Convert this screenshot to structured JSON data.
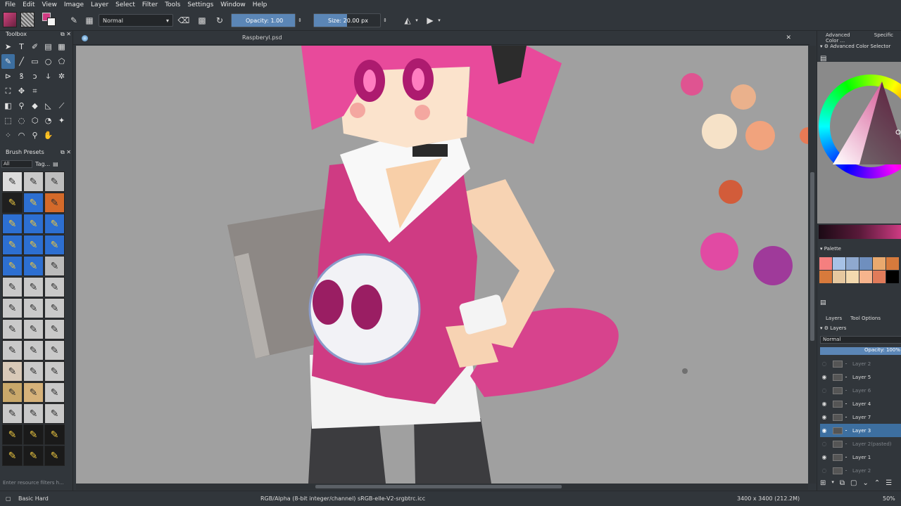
{
  "menu": [
    "File",
    "Edit",
    "View",
    "Image",
    "Layer",
    "Select",
    "Filter",
    "Tools",
    "Settings",
    "Window",
    "Help"
  ],
  "toolbar": {
    "blend_mode": "Normal",
    "opacity_label": "Opacity:",
    "opacity_value": "1.00",
    "opacity_fraction": 1.0,
    "size_label": "Size:",
    "size_value": "20.00 px",
    "size_fraction": 0.5
  },
  "document": {
    "title": "Raspberyl.psd"
  },
  "toolbox": {
    "title": "Toolbox"
  },
  "brush_presets": {
    "title": "Brush Presets",
    "filter_select": "All",
    "tag_label": "Tag...",
    "filter_placeholder": "Enter resource filters h..."
  },
  "right": {
    "tabs": [
      "Advanced Color ...",
      "Specific"
    ],
    "color_selector_title": "Advanced Color Selector",
    "palette_title": "Palette",
    "palette_colors": [
      "#f57f7f",
      "#a7c2e6",
      "#8fa9cf",
      "#6f8fbe",
      "#e9a96e",
      "#d77a3c",
      "#d77a3c",
      "#e6c89f",
      "#f3d9ae",
      "#f6b48d",
      "#e07b5a",
      "#000000"
    ],
    "layer_tabs": [
      "Layers",
      "Tool Options"
    ],
    "layers_title": "Layers",
    "layers_blend": "Normal",
    "layers_opacity": "Opacity:  100%",
    "layers": [
      {
        "name": "Layer 2",
        "visible": false
      },
      {
        "name": "Layer 5",
        "visible": true
      },
      {
        "name": "Layer 6",
        "visible": false
      },
      {
        "name": "Layer 4",
        "visible": true
      },
      {
        "name": "Layer 7",
        "visible": true
      },
      {
        "name": "Layer 3",
        "visible": true,
        "selected": true
      },
      {
        "name": "Layer 2(pasted)",
        "visible": false
      },
      {
        "name": "Layer 1",
        "visible": true
      },
      {
        "name": "Layer 2",
        "visible": false
      }
    ]
  },
  "status": {
    "brush": "Basic Hard",
    "color_info": "RGB/Alpha (8-bit integer/channel)  sRGB-elle-V2-srgbtrc.icc",
    "dimensions": "3400 x 3400 (212.2M)",
    "zoom": "50%"
  },
  "colors": {
    "accent": "#5b86b6",
    "bg": "#31363b",
    "fg_color": "#cf3b83",
    "canvas_bg": "#a0a0a0"
  }
}
